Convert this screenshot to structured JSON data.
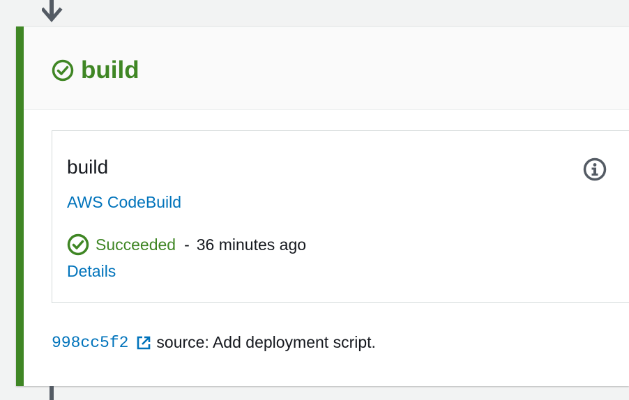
{
  "stage": {
    "title": "build",
    "status": "succeeded",
    "accent_color": "#3f8624"
  },
  "action": {
    "name": "build",
    "provider": "AWS CodeBuild",
    "status": "Succeeded",
    "separator": "-",
    "time_ago": "36 minutes ago",
    "details_label": "Details",
    "info_icon": "info-icon"
  },
  "revision": {
    "commit_id": "998cc5f2",
    "external_icon": "external-link-icon",
    "message": "source: Add deployment script."
  },
  "colors": {
    "success": "#3f8624",
    "link": "#0073bb",
    "connector": "#545b64"
  }
}
